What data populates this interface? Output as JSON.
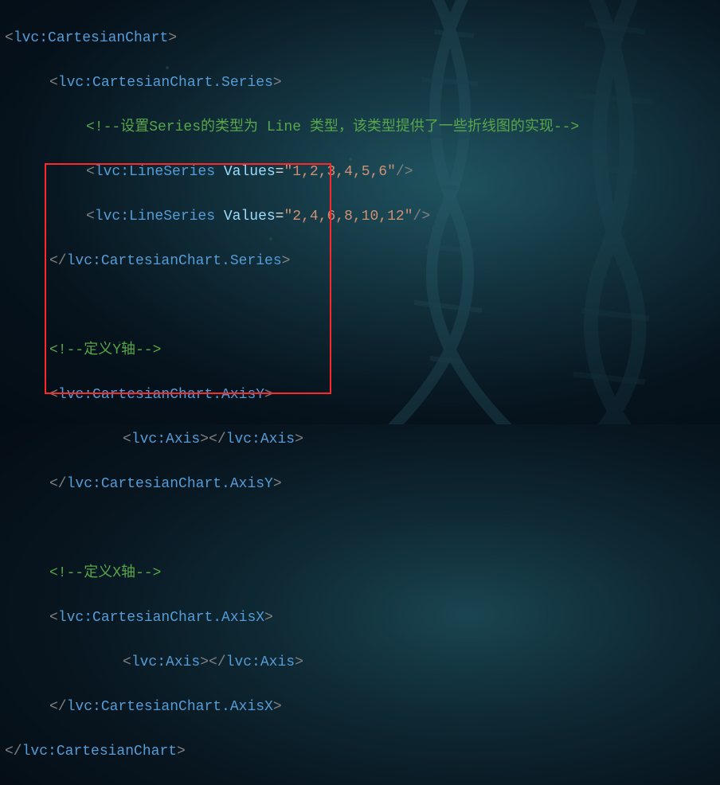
{
  "code": {
    "tag_chart": "lvc:CartesianChart",
    "tag_series": "lvc:CartesianChart.Series",
    "tag_lineseries": "lvc:LineSeries",
    "tag_axisy": "lvc:CartesianChart.AxisY",
    "tag_axisx": "lvc:CartesianChart.AxisX",
    "tag_axis": "lvc:Axis",
    "attr_values": "Values",
    "val1": "\"1,2,3,4,5,6\"",
    "val2": "\"2,4,6,8,10,12\"",
    "comment_series": "<!--设置Series的类型为 Line 类型，该类型提供了一些折线图的实现-->",
    "comment_y": "<!--定义Y轴-->",
    "comment_x": "<!--定义X轴-->",
    "lt": "<",
    "gt": ">",
    "ltsl": "</",
    "slgt": "/>",
    "eq": "="
  }
}
